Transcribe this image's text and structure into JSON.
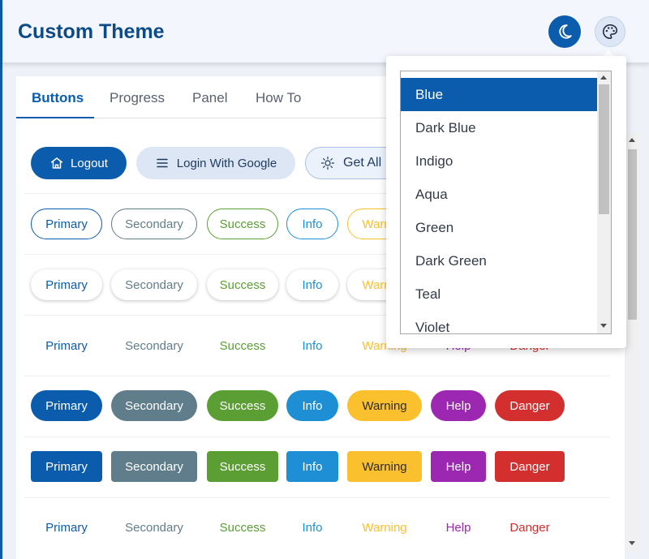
{
  "header": {
    "title": "Custom Theme"
  },
  "icons": {
    "theme_toggle": "moon-icon",
    "palette": "palette-icon"
  },
  "tabs": [
    {
      "label": "Buttons",
      "active": true
    },
    {
      "label": "Progress",
      "active": false
    },
    {
      "label": "Panel",
      "active": false
    },
    {
      "label": "How To",
      "active": false
    }
  ],
  "action_buttons": {
    "logout": "Logout",
    "login_google": "Login With Google",
    "get_all": "Get All"
  },
  "variants": [
    "Primary",
    "Secondary",
    "Success",
    "Info",
    "Warning",
    "Help",
    "Danger"
  ],
  "colors": {
    "primary": "#0b5cad",
    "secondary": "#607d8b",
    "success": "#5b9e34",
    "info": "#1e8fd5",
    "warning": "#fbc02d",
    "help": "#9c27b0",
    "danger": "#d32f2f",
    "header_title": "#0d4a88"
  },
  "theme_menu": {
    "selected": "Blue",
    "options": [
      "Blue",
      "Dark Blue",
      "Indigo",
      "Aqua",
      "Green",
      "Dark Green",
      "Teal",
      "Violet"
    ]
  }
}
